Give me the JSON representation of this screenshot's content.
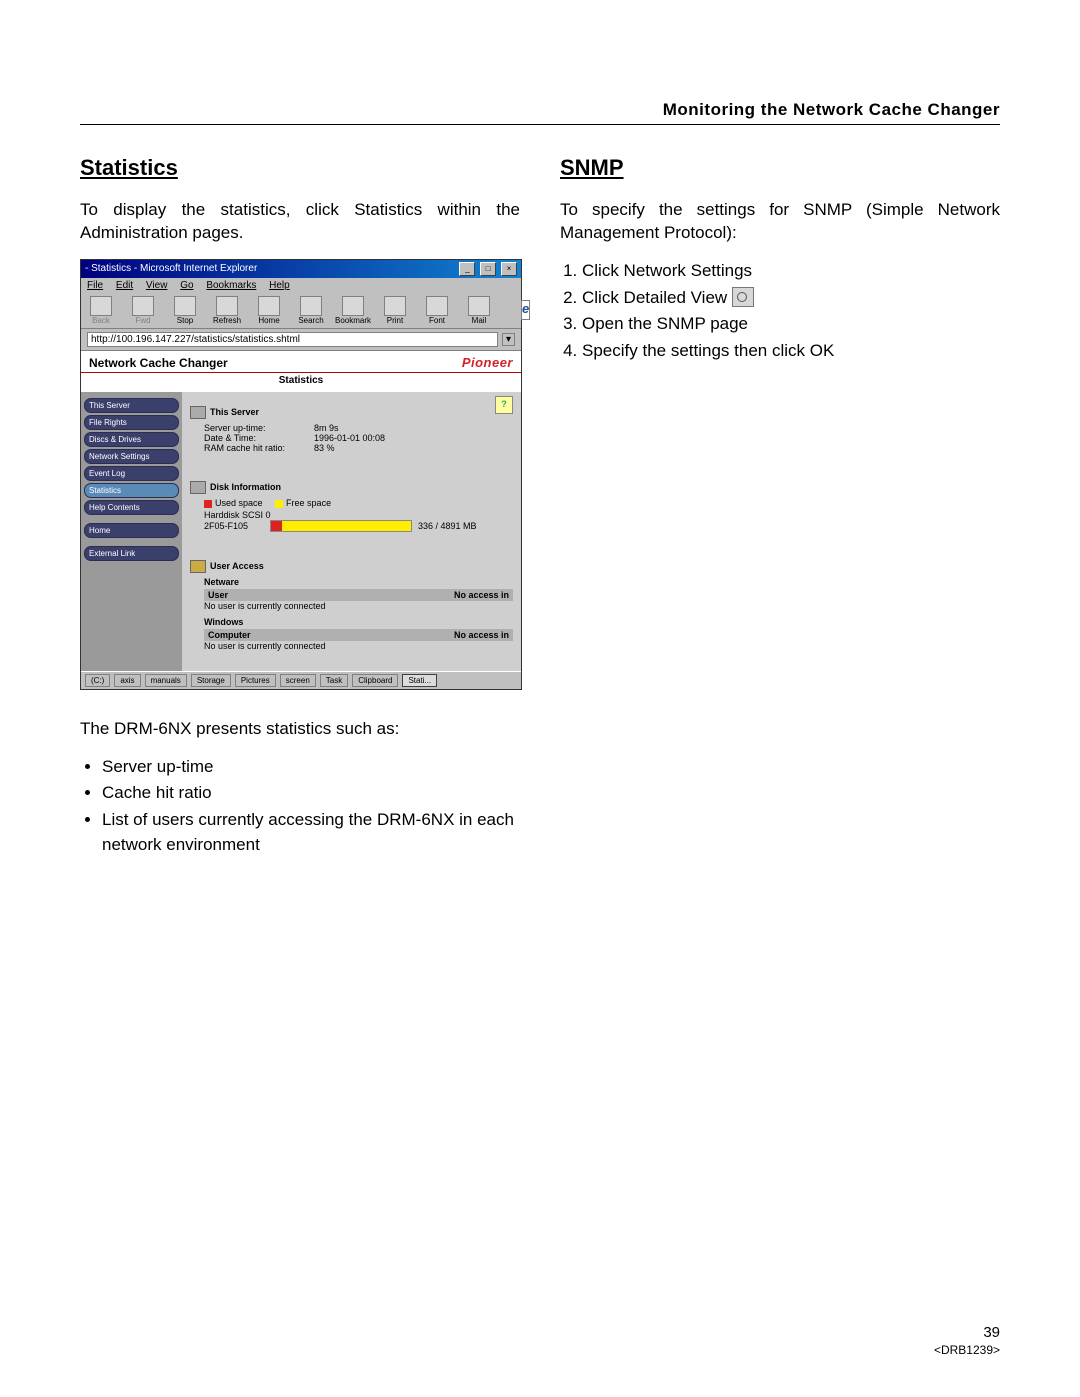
{
  "header": {
    "title": "Monitoring the Network Cache Changer"
  },
  "left": {
    "heading": "Statistics",
    "intro": "To display the statistics, click Statistics within the Administration pages.",
    "after": "The DRM-6NX presents statistics such as:",
    "bullets": [
      "Server up-time",
      "Cache hit ratio",
      "List of users currently accessing the DRM-6NX in each network environment"
    ]
  },
  "right": {
    "heading": "SNMP",
    "intro": "To specify the settings for SNMP (Simple Network Management Protocol):",
    "steps": [
      "Click Network Settings",
      "Click Detailed View",
      "Open the SNMP page",
      "Specify the settings then click OK"
    ]
  },
  "screenshot": {
    "window_title": " - Statistics - Microsoft Internet Explorer",
    "menus": [
      "File",
      "Edit",
      "View",
      "Go",
      "Bookmarks",
      "Help"
    ],
    "toolbar": [
      "Back",
      "Fwd",
      "Stop",
      "Refresh",
      "Home",
      "Search",
      "Bookmark",
      "Print",
      "Font",
      "Mail"
    ],
    "address": "http://100.196.147.227/statistics/statistics.shtml",
    "header_title": "Network Cache Changer",
    "brand": "Pioneer",
    "subheader": "Statistics",
    "sidebar": {
      "items": [
        "This Server",
        "File Rights",
        "Discs & Drives",
        "Network Settings",
        "Event Log",
        "Statistics",
        "Help Contents"
      ],
      "home": "Home",
      "external": "External Link"
    },
    "help_icon": "?",
    "this_server": {
      "title": "This Server",
      "uptime_k": "Server up-time:",
      "uptime_v": "8m 9s",
      "date_k": "Date & Time:",
      "date_v": "1996-01-01 00:08",
      "cache_k": "RAM cache hit ratio:",
      "cache_v": "83 %"
    },
    "disk": {
      "title": "Disk Information",
      "legend_used": "Used space",
      "legend_free": "Free space",
      "hd_label": "Harddisk SCSI 0",
      "row_name": "2F05-F105",
      "row_size": "336 / 4891 MB"
    },
    "user_access": {
      "title": "User Access",
      "netware": "Netware",
      "netware_user": "User",
      "netware_col2": "No access in",
      "netware_msg": "No user is currently connected",
      "windows": "Windows",
      "windows_comp": "Computer",
      "windows_col2": "No access in",
      "windows_msg": "No user is currently connected"
    },
    "taskbar": [
      "(C:)",
      "axis",
      "manuals",
      "Storage",
      "Pictures",
      "screen",
      "Task",
      "Clipboard",
      "Stati..."
    ]
  },
  "footer": {
    "page": "39",
    "docid": "<DRB1239>"
  }
}
